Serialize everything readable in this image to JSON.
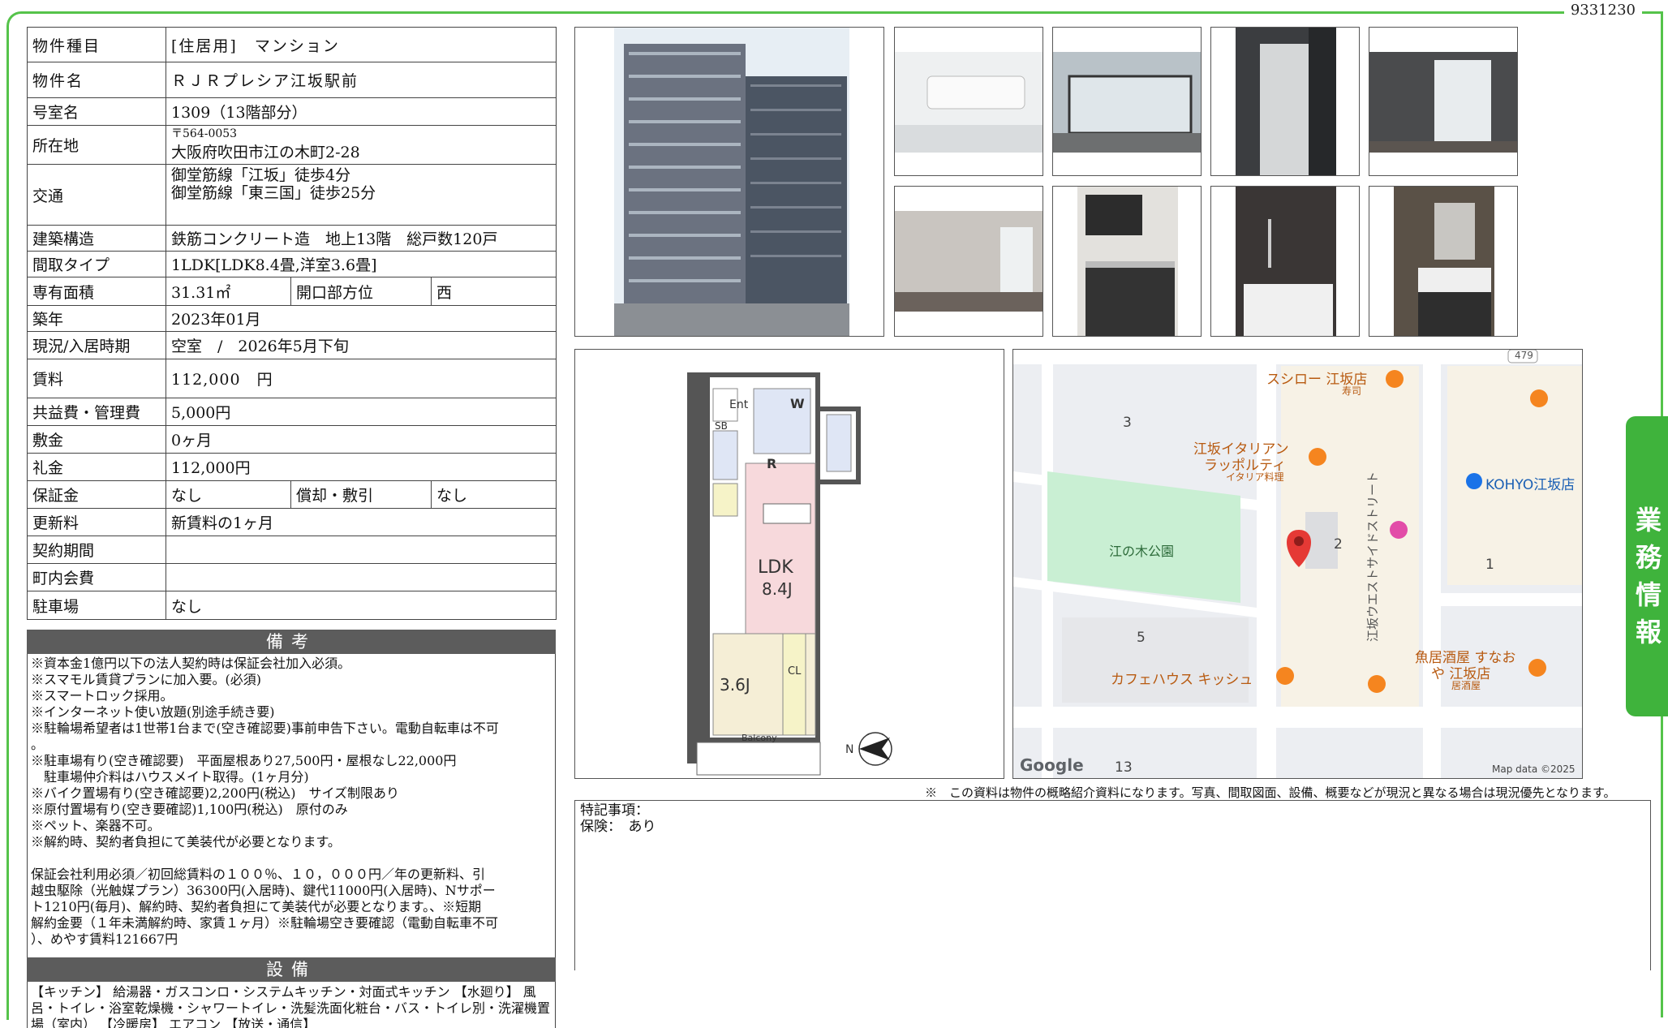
{
  "page_id": "9331230",
  "side_tab": "業務情報",
  "info": {
    "property_type_label": "物件種目",
    "property_type_value": "[住居用]　マンション",
    "name_label": "物件名",
    "name_value": "ＲＪＲプレシア江坂駅前",
    "room_label": "号室名",
    "room_value": "1309（13階部分）",
    "address_label": "所在地",
    "postal": "〒564-0053",
    "address_value": "大阪府吹田市江の木町2-28",
    "transport_label": "交通",
    "transport_line1": "御堂筋線「江坂」徒歩4分",
    "transport_line2": "御堂筋線「東三国」徒歩25分",
    "structure_label": "建築構造",
    "structure_value": "鉄筋コンクリート造　地上13階　総戸数120戸",
    "layout_label": "間取タイプ",
    "layout_value": "1LDK[LDK8.4畳,洋室3.6畳]",
    "area_label": "専有面積",
    "area_value": "31.31㎡",
    "direction_label": "開口部方位",
    "direction_value": "西",
    "built_label": "築年",
    "built_value": "2023年01月",
    "status_label": "現況/入居時期",
    "status_value": "空室　/　2026年5月下旬",
    "rent_label": "賃料",
    "rent_value": "112,000　円",
    "common_label": "共益費・管理費",
    "common_value": "5,000円",
    "deposit_label": "敷金",
    "deposit_value": "0ヶ月",
    "key_money_label": "礼金",
    "key_money_value": "112,000円",
    "guarantee_label": "保証金",
    "guarantee_value": "なし",
    "amort_label": "償却・敷引",
    "amort_value": "なし",
    "renewal_label": "更新料",
    "renewal_value": "新賃料の1ヶ月",
    "contract_label": "契約期間",
    "contract_value": "",
    "town_label": "町内会費",
    "town_value": "",
    "parking_label": "駐車場",
    "parking_value": "なし"
  },
  "remarks_header": "備考",
  "remarks": [
    "※資本金1億円以下の法人契約時は保証会社加入必須。",
    "※スマモル賃貸プランに加入要。(必須)",
    "※スマートロック採用。",
    "※インターネット使い放題(別途手続き要)",
    "※駐輪場希望者は1世帯1台まで(空き確認要)事前申告下さい。電動自転車は不可",
    "。",
    "※駐車場有り(空き確認要)　平面屋根あり27,500円・屋根なし22,000円",
    "　駐車場仲介料はハウスメイト取得。(1ヶ月分)",
    "※バイク置場有り(空き確認要)2,200円(税込)　サイズ制限あり",
    "※原付置場有り(空き要確認)1,100円(税込)　原付のみ",
    "※ペット、楽器不可。",
    "※解約時、契約者負担にて美装代が必要となります。",
    "",
    "保証会社利用必須／初回総賃料の１００％、１０，０００円／年の更新料、引",
    "越虫駆除（光触媒プラン）36300円(入居時)、鍵代11000円(入居時)、Nサポー",
    "ト1210円(毎月)、解約時、契約者負担にて美装代が必要となります。、※短期",
    "解約金要（１年未満解約時、家賃１ヶ月）※駐輪場空き要確認（電動自転車不可",
    "）、めやす賃料121667円"
  ],
  "equipment_header": "設備",
  "equipment": "【キッチン】 給湯器・ガスコンロ・システムキッチン・対面式キッチン 【水廻り】 風呂・トイレ・浴室乾燥機・シャワートイレ・洗髪洗面化粧台・バス・トイレ別・洗濯機置場（室内） 【冷暖房】 エアコン 【放送・通信】",
  "floorplan": {
    "ent": "Ent",
    "w": "W",
    "sb": "SB",
    "r": "R",
    "ldk": "LDK",
    "ldk_size": "8.4J",
    "room": "3.6J",
    "cl": "CL",
    "balcony": "Balcony",
    "compass": "N"
  },
  "map": {
    "road_number": "479",
    "block_3": "3",
    "block_2": "2",
    "block_1": "1",
    "block_5": "5",
    "block_13": "13",
    "park": "江の木公園",
    "poi_sushiro": "スシロー 江坂店",
    "poi_sushiro_sub": "寿司",
    "poi_italian1": "江坂イタリアン",
    "poi_italian2": "ラッポルティ",
    "poi_italian_sub": "イタリア料理",
    "poi_kohyo": "KOHYO江坂店",
    "poi_cafe": "カフェハウス キッシュ",
    "poi_izakaya1": "魚居酒屋 すなお",
    "poi_izakaya2": "や 江坂店",
    "poi_izakaya_sub": "居酒屋",
    "street": "江坂ウエストサイドストリート",
    "google": "Google",
    "map_data": "Map data ©2025",
    "colors": {
      "park": "#c9efd3",
      "road": "#ffffff",
      "pin": "#e53935",
      "poi": "#f5851f",
      "shop": "#1a73e8"
    }
  },
  "disclaimer": "※　この資料は物件の概略紹介資料になります。写真、間取図面、設備、概要などが現況と異なる場合は現況優先となります。",
  "special_label": "特記事項：",
  "insurance": "保険：　あり",
  "colors": {
    "accent": "#3fb33c",
    "header": "#5c5c5c"
  }
}
